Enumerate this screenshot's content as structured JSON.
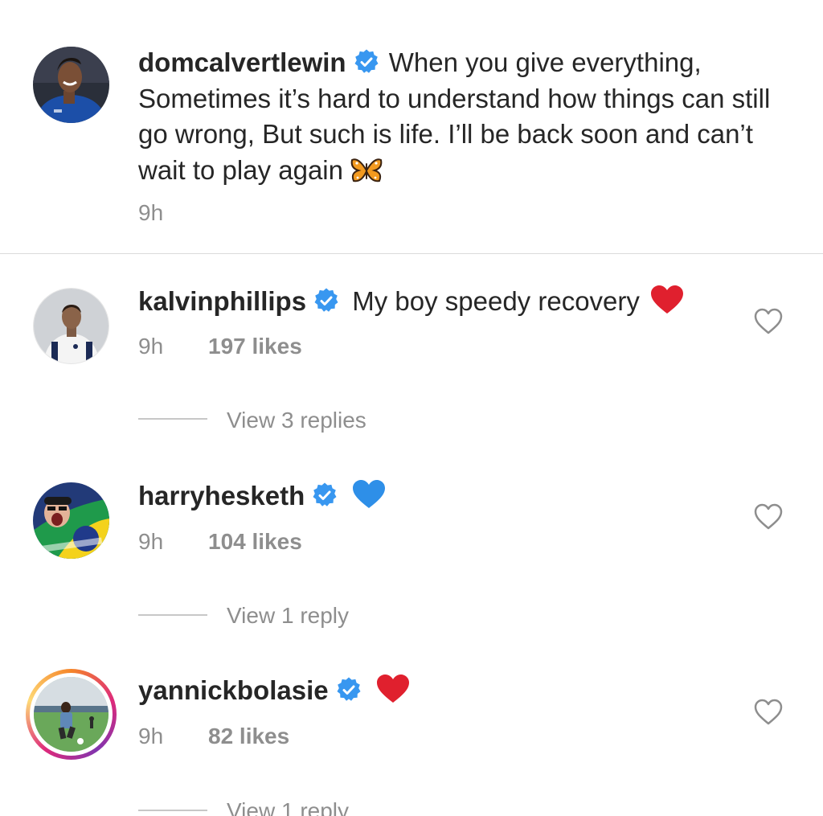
{
  "caption": {
    "username": "domcalvertlewin",
    "text": "When you give everything, Sometimes it’s hard to understand how things can still go wrong, But such is life. I’ll be back soon and can’t wait to play again",
    "emoji": "butterfly-emoji",
    "time": "9h"
  },
  "comments": [
    {
      "username": "kalvinphillips",
      "text": "My boy speedy recovery",
      "emoji": "red-heart-emoji",
      "time": "9h",
      "likes": "197 likes",
      "replies": "View 3 replies"
    },
    {
      "username": "harryhesketh",
      "text": "",
      "emoji": "blue-heart-emoji",
      "time": "9h",
      "likes": "104 likes",
      "replies": "View 1 reply"
    },
    {
      "username": "yannickbolasie",
      "text": "",
      "emoji": "red-heart-emoji",
      "time": "9h",
      "likes": "82 likes",
      "replies": "View 1 reply"
    }
  ],
  "colors": {
    "verified": "#3897f0",
    "secondary_text": "#8e8e8e",
    "primary_text": "#262626",
    "red_heart": "#e0202e",
    "blue_heart": "#2e8fe8"
  },
  "icons": {
    "verified": "verified-badge-icon",
    "like": "heart-outline-icon"
  }
}
